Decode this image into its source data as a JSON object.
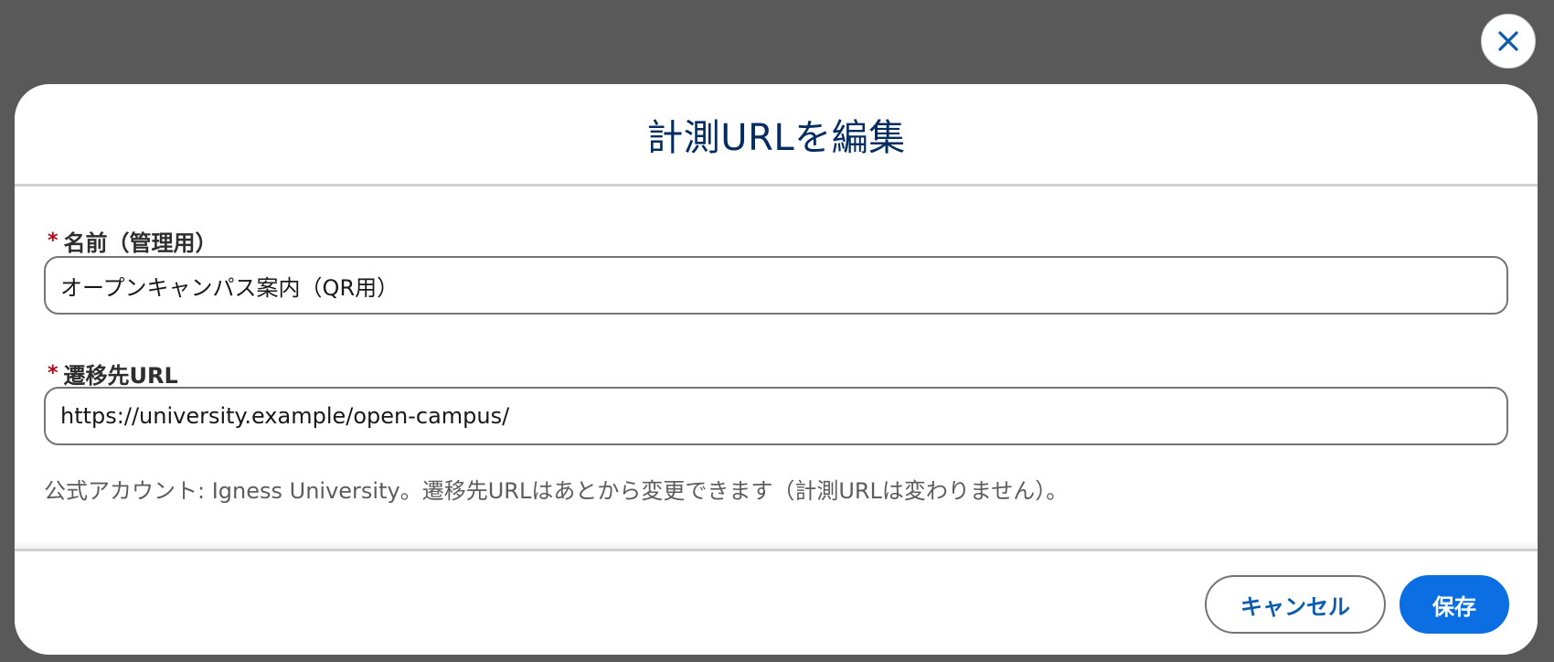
{
  "dialog": {
    "title": "計測URLを編集",
    "close_icon": "close-icon"
  },
  "form": {
    "name_field": {
      "label": "名前（管理用）",
      "required_mark": "*",
      "value": "オープンキャンパス案内（QR用）"
    },
    "url_field": {
      "label": "遷移先URL",
      "required_mark": "*",
      "value": "https://university.example/open-campus/"
    },
    "help_text": "公式アカウント: Igness University。遷移先URLはあとから変更できます（計測URLは変わりません）。"
  },
  "footer": {
    "cancel_label": "キャンセル",
    "save_label": "保存"
  },
  "colors": {
    "overlay": "#595959",
    "title": "#032d60",
    "required": "#ba0517",
    "link_blue": "#0b5cab",
    "brand_blue": "#0b6fe3"
  }
}
